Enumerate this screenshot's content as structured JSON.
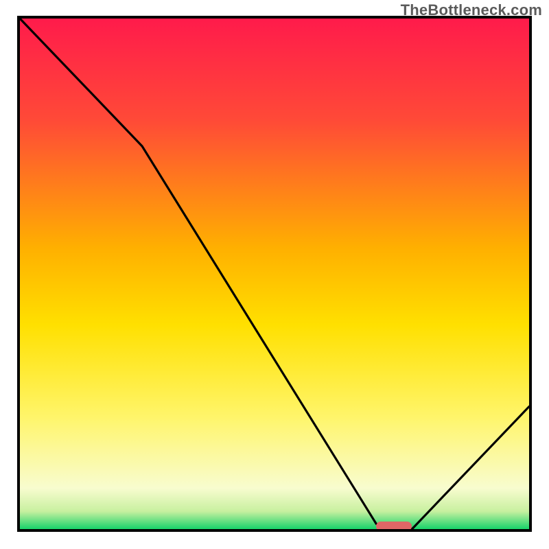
{
  "watermark": "TheBottleneck.com",
  "colors": {
    "frame": "#000000",
    "curve": "#000000",
    "marker": "#e06666",
    "gradient_top": "#ff1b4b",
    "gradient_mid_upper": "#ff6a2a",
    "gradient_mid": "#ffd400",
    "gradient_mid_lower": "#fff56a",
    "gradient_pale": "#f8fccf",
    "gradient_bottom": "#17d36a"
  },
  "chart_data": {
    "type": "line",
    "title": "",
    "xlabel": "",
    "ylabel": "",
    "xlim": [
      0,
      100
    ],
    "ylim": [
      0,
      100
    ],
    "grid": false,
    "series": [
      {
        "name": "bottleneck-curve",
        "x": [
          0,
          24,
          70,
          77,
          100
        ],
        "values": [
          100,
          75,
          1,
          0,
          24
        ]
      }
    ],
    "annotations": [
      {
        "name": "optimal-marker",
        "x_start": 70,
        "x_end": 77,
        "y": 0
      }
    ],
    "background_gradient": [
      {
        "stop": 0.0,
        "color": "#ff1b4b"
      },
      {
        "stop": 0.2,
        "color": "#ff4a37"
      },
      {
        "stop": 0.45,
        "color": "#ffb000"
      },
      {
        "stop": 0.6,
        "color": "#ffe000"
      },
      {
        "stop": 0.78,
        "color": "#fff56a"
      },
      {
        "stop": 0.92,
        "color": "#f8fccf"
      },
      {
        "stop": 0.965,
        "color": "#c8f0a0"
      },
      {
        "stop": 1.0,
        "color": "#17d36a"
      }
    ]
  },
  "plot": {
    "inner_width": 742,
    "inner_height": 744
  }
}
